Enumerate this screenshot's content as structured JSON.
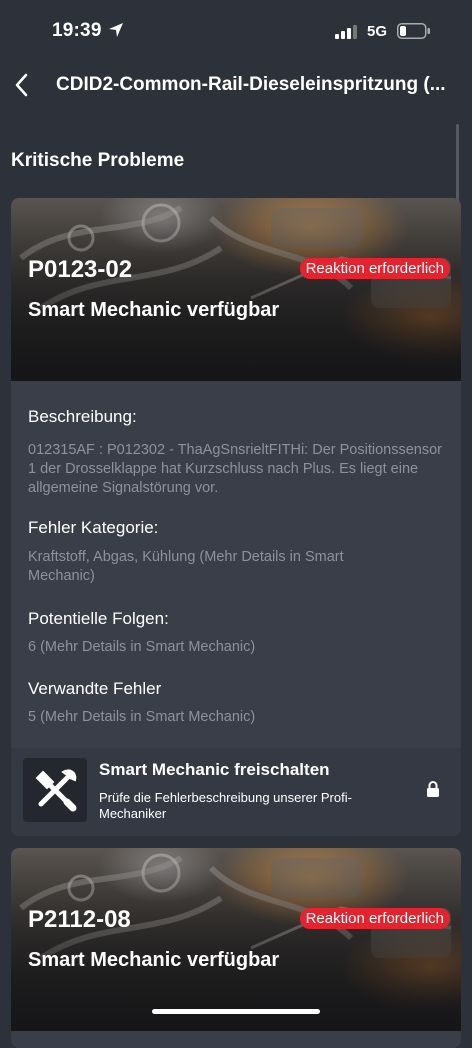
{
  "status": {
    "time": "19:39",
    "network": "5G"
  },
  "nav": {
    "title": "CDID2-Common-Rail-Dieseleinspritzung (..."
  },
  "section_title": "Kritische Probleme",
  "cards": [
    {
      "code": "P0123-02",
      "badge": "Reaktion erforderlich",
      "subtitle": "Smart Mechanic verfügbar",
      "description_label": "Beschreibung:",
      "description": "012315AF : P012302 - ThaAgSnsrieltFITHi: Der Positionssensor 1 der Drosselklappe hat Kurzschluss nach Plus. Es liegt eine allgemeine Signalstörung vor.",
      "category_label": "Fehler Kategorie:",
      "category": "Kraftstoff, Abgas, Kühlung (Mehr Details in Smart Mechanic)",
      "consequences_label": "Potentielle Folgen:",
      "consequences": "6 (Mehr Details in Smart Mechanic)",
      "related_label": "Verwandte Fehler",
      "related": "5 (Mehr Details in Smart Mechanic)",
      "unlock_title": "Smart Mechanic freischalten",
      "unlock_subtitle": "Prüfe die Fehlerbeschreibung unserer Profi-Mechaniker"
    },
    {
      "code": "P2112-08",
      "badge": "Reaktion erforderlich",
      "subtitle": "Smart Mechanic verfügbar"
    }
  ],
  "colors": {
    "badge": "#e5232f",
    "card": "#3a3e48",
    "background": "#2d313a",
    "muted_text": "#8d929b"
  }
}
